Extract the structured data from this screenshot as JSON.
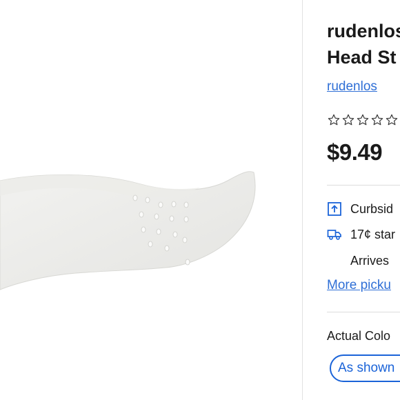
{
  "product": {
    "title_line1": "rudenlos",
    "title_line2": "Head St",
    "brand_link": "rudenlos",
    "price": "$9.49",
    "rating_stars": 5,
    "filled_stars": 0
  },
  "fulfillment": {
    "curbside": "Curbsid",
    "shipping": "17¢ star",
    "arrives": "Arrives",
    "more_pickup": "More picku"
  },
  "variant": {
    "label": "Actual Colo",
    "selected": "As shown"
  },
  "colors": {
    "link": "#2f6fd6",
    "chip": "#1a63d8"
  },
  "icons": [
    "curbside-pickup-icon",
    "delivery-truck-icon",
    "star-outline-icon"
  ]
}
